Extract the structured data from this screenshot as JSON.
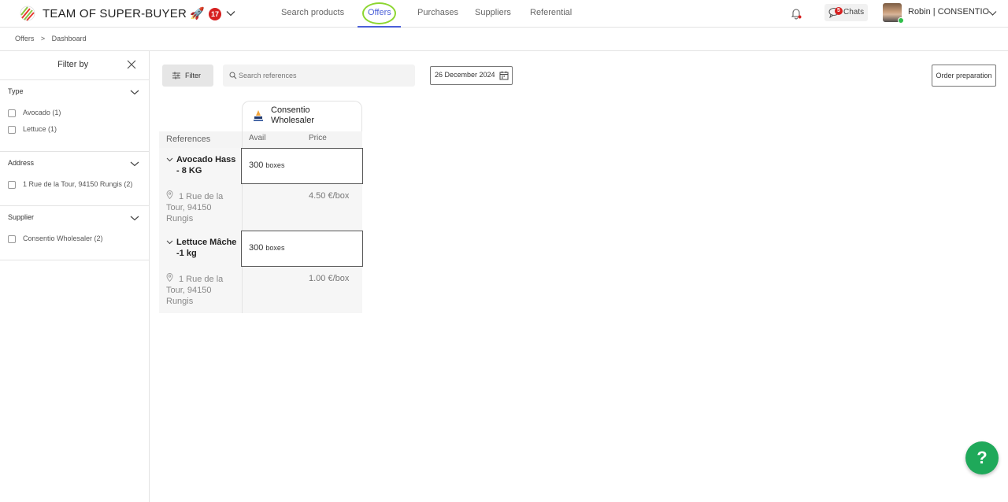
{
  "header": {
    "team_name": "TEAM OF SUPER-BUYER 🚀 ...",
    "team_badge": "17",
    "nav": [
      {
        "label": "Search products"
      },
      {
        "label": "Offers",
        "active": true
      },
      {
        "label": "Purchases"
      },
      {
        "label": "Suppliers"
      },
      {
        "label": "Referential"
      }
    ],
    "chats_badge": "5",
    "chats_label": "Chats",
    "user_name": "Robin | CONSENTIO",
    "accent_color": "#4a5fd8"
  },
  "breadcrumb": {
    "items": [
      "Offers",
      ">",
      "Dashboard"
    ]
  },
  "sidebar": {
    "title": "Filter by",
    "sections": [
      {
        "title": "Type",
        "options": [
          "Avocado (1)",
          "Lettuce (1)"
        ]
      },
      {
        "title": "Address",
        "options": [
          "1 Rue de la Tour, 94150 Rungis (2)"
        ]
      },
      {
        "title": "Supplier",
        "options": [
          "Consentio Wholesaler (2)"
        ]
      }
    ]
  },
  "toolbar": {
    "filter_label": "Filter",
    "search_placeholder": "Search references",
    "date": "26 December 2024",
    "order_label": "Order preparation"
  },
  "table": {
    "supplier": "Consentio Wholesaler",
    "col_references": "References",
    "col_avail": "Avail",
    "col_price": "Price",
    "rows": [
      {
        "name": "Avocado Hass - 8 KG",
        "qty": "300",
        "unit": "boxes",
        "address": "1 Rue de la Tour, 94150 Rungis",
        "price": "4.50 €/box"
      },
      {
        "name": "Lettuce Mâche -1 kg",
        "qty": "300",
        "unit": "boxes",
        "address": "1 Rue de la Tour, 94150 Rungis",
        "price": "1.00 €/box"
      }
    ]
  },
  "help_label": "?"
}
